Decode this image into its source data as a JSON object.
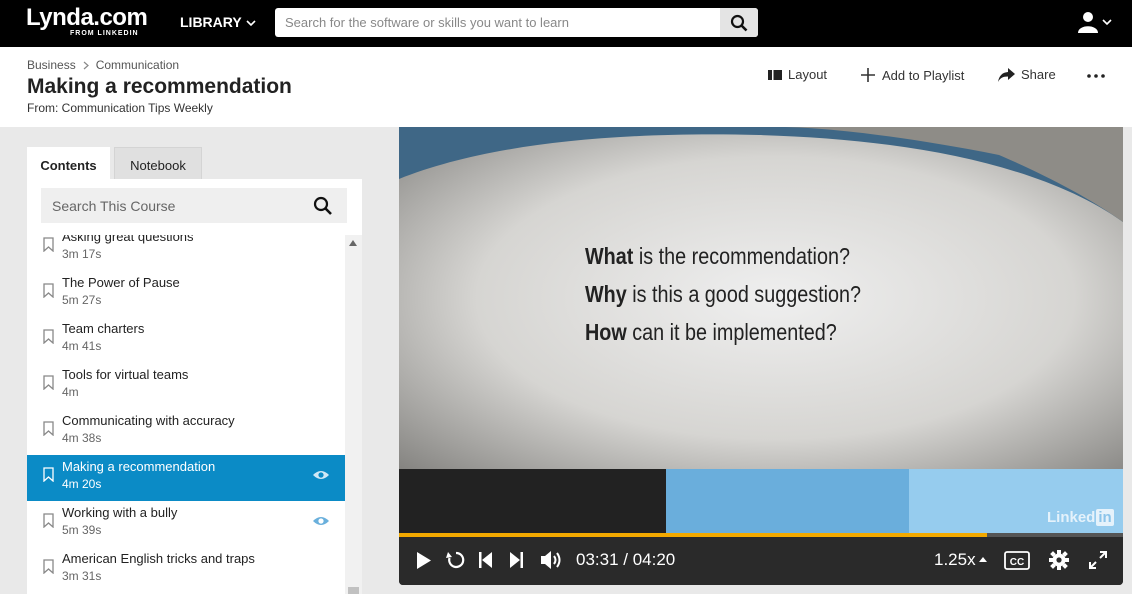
{
  "topbar": {
    "logo_main": "Lynda.com",
    "logo_sub": "FROM LINKEDIN",
    "library_label": "LIBRARY",
    "search_placeholder": "Search for the software or skills you want to learn"
  },
  "header": {
    "breadcrumb": [
      "Business",
      "Communication"
    ],
    "title": "Making a recommendation",
    "from": "From: Communication Tips Weekly",
    "actions": {
      "layout": "Layout",
      "add_to_playlist": "Add to Playlist",
      "share": "Share"
    }
  },
  "sidebar": {
    "tabs": [
      "Contents",
      "Notebook"
    ],
    "search_placeholder": "Search This Course",
    "items": [
      {
        "name": "Asking great questions",
        "duration": "3m 17s",
        "active": false,
        "watched": false
      },
      {
        "name": "The Power of Pause",
        "duration": "5m 27s",
        "active": false,
        "watched": false
      },
      {
        "name": "Team charters",
        "duration": "4m 41s",
        "active": false,
        "watched": false
      },
      {
        "name": "Tools for virtual teams",
        "duration": "4m",
        "active": false,
        "watched": false
      },
      {
        "name": "Communicating with accuracy",
        "duration": "4m 38s",
        "active": false,
        "watched": false
      },
      {
        "name": "Making a recommendation",
        "duration": "4m 20s",
        "active": true,
        "watched": true
      },
      {
        "name": "Working with a bully",
        "duration": "5m 39s",
        "active": false,
        "watched": true
      },
      {
        "name": "American English tricks and traps",
        "duration": "3m 31s",
        "active": false,
        "watched": false
      }
    ]
  },
  "video": {
    "slide": {
      "line1_bold": "What",
      "line1_rest": " is the recommendation?",
      "line2_bold": "Why",
      "line2_rest": " is this a good suggestion?",
      "line3_bold": "How",
      "line3_rest": " can it be implemented?"
    },
    "watermark": "Linked",
    "watermark_in": "in",
    "current_time": "03:31",
    "duration": "04:20",
    "time_display": "03:31 / 04:20",
    "speed": "1.25x",
    "progress_fraction": 0.812,
    "cc_label": "CC"
  },
  "colors": {
    "active_item": "#0b8bc6",
    "progress": "#f2a900",
    "stripe_dark": "#222222",
    "stripe_mid": "#6aaedc",
    "stripe_light": "#96ccee"
  },
  "icons": [
    "search-icon",
    "chevron-down-icon",
    "user-icon",
    "layout-icon",
    "plus-icon",
    "share-icon",
    "more-icon",
    "bookmark-icon",
    "eye-icon",
    "play-icon",
    "replay-icon",
    "skip-back-icon",
    "skip-forward-icon",
    "volume-icon",
    "settings-icon",
    "fullscreen-icon"
  ]
}
